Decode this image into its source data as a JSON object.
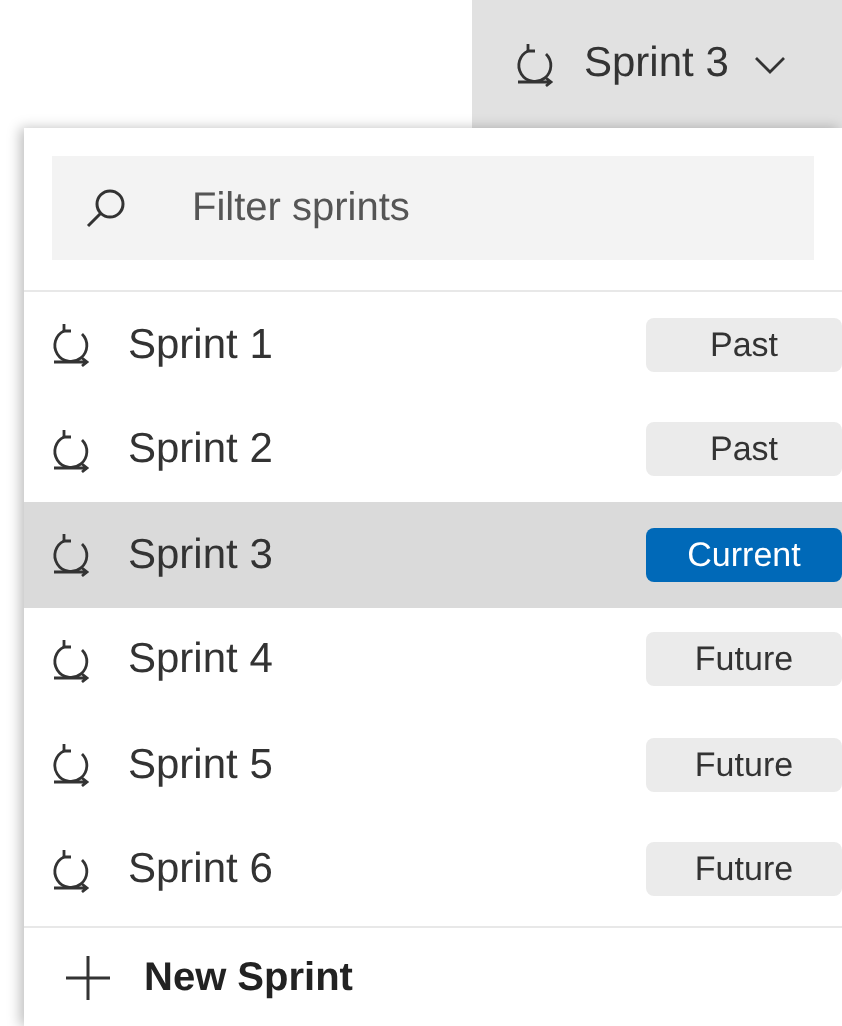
{
  "picker": {
    "label": "Sprint 3"
  },
  "search": {
    "placeholder": "Filter sprints"
  },
  "sprints": [
    {
      "name": "Sprint 1",
      "status": "Past",
      "kind": "past",
      "selected": false
    },
    {
      "name": "Sprint 2",
      "status": "Past",
      "kind": "past",
      "selected": false
    },
    {
      "name": "Sprint 3",
      "status": "Current",
      "kind": "current",
      "selected": true
    },
    {
      "name": "Sprint 4",
      "status": "Future",
      "kind": "future",
      "selected": false
    },
    {
      "name": "Sprint 5",
      "status": "Future",
      "kind": "future",
      "selected": false
    },
    {
      "name": "Sprint 6",
      "status": "Future",
      "kind": "future",
      "selected": false
    }
  ],
  "new_button": {
    "label": "New Sprint"
  }
}
